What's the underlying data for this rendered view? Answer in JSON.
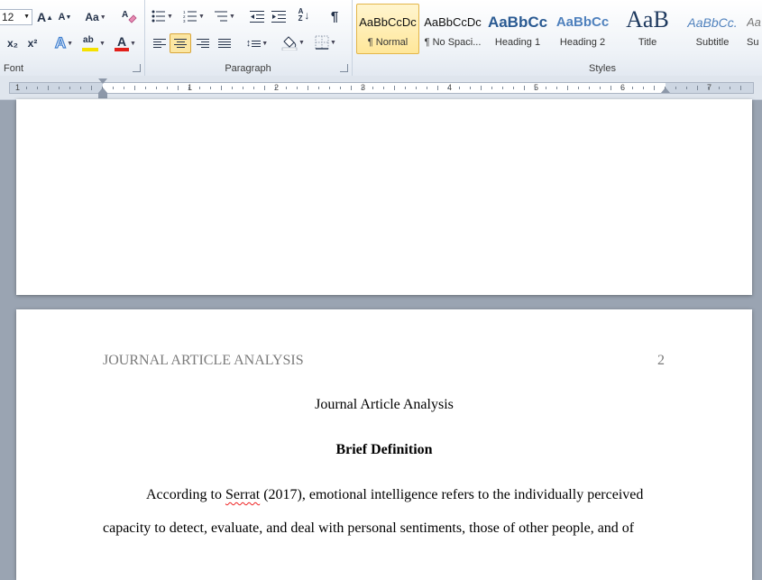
{
  "ribbon": {
    "font_group": {
      "label": "Font",
      "font_size": "12",
      "grow_font": "A",
      "shrink_font": "A",
      "change_case": "Aa",
      "subscript": "x₂",
      "superscript": "x²",
      "text_effects": "A",
      "highlight": "ab",
      "font_color": "A"
    },
    "paragraph_group": {
      "label": "Paragraph",
      "show_marks": "¶",
      "sort_a": "A",
      "sort_z": "Z"
    },
    "styles_group": {
      "label": "Styles",
      "items": [
        {
          "sample": "AaBbCcDc",
          "name": "¶ Normal"
        },
        {
          "sample": "AaBbCcDc",
          "name": "¶ No Spaci..."
        },
        {
          "sample": "AaBbCc",
          "name": "Heading 1"
        },
        {
          "sample": "AaBbCc",
          "name": "Heading 2"
        },
        {
          "sample": "AaB",
          "name": "Title"
        },
        {
          "sample": "AaBbCc.",
          "name": "Subtitle"
        },
        {
          "sample": "Aa",
          "name": "Su"
        }
      ]
    }
  },
  "ruler": {
    "numbers": [
      "1",
      "1",
      "2",
      "3",
      "4",
      "5",
      "6",
      "7"
    ]
  },
  "colors": {
    "accent_selected": "#fbe6a2",
    "header_gray": "#7a7a7a",
    "highlight_yellow": "#f5e100",
    "font_red": "#e2201a"
  },
  "document": {
    "page2": {
      "header_left": "JOURNAL ARTICLE ANALYSIS",
      "page_number": "2",
      "title": "Journal Article Analysis",
      "heading": "Brief Definition",
      "para_line1_a": "According to ",
      "para_line1_cite": "Serrat",
      "para_line1_b": " (2017), emotional intelligence refers to the individually perceived",
      "para_line2": "capacity to detect, evaluate, and deal with personal sentiments, those of other people, and of"
    }
  }
}
